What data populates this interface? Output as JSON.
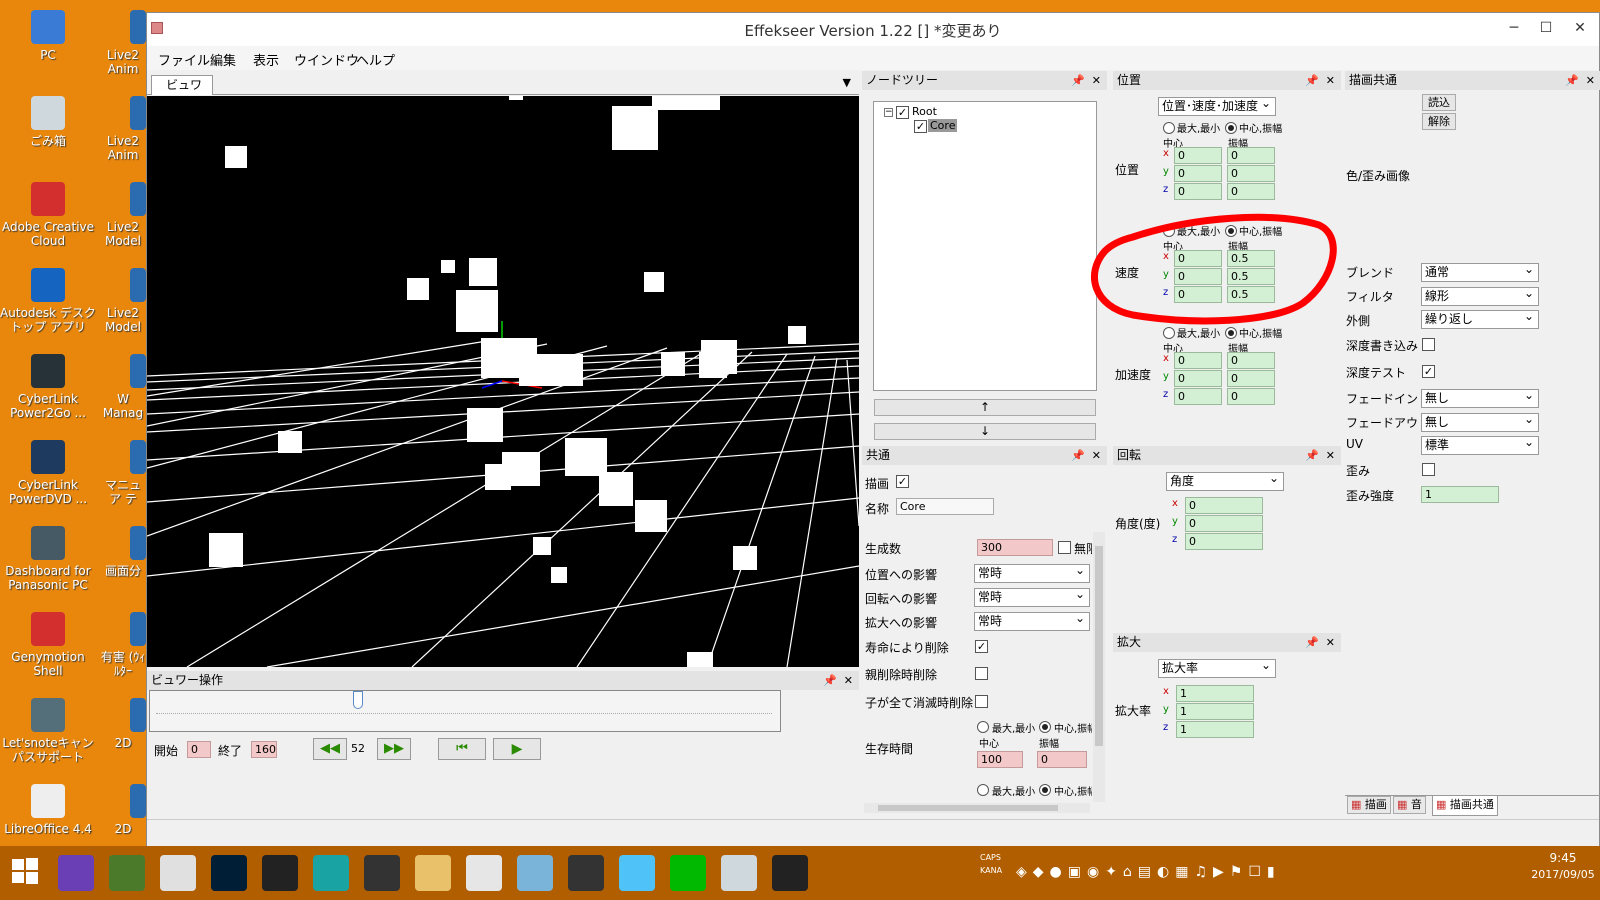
{
  "desktop": {
    "icons_left": [
      {
        "label": "PC",
        "color": "#3a7bd5"
      },
      {
        "label": "ごみ箱",
        "color": "#cfd8dc"
      },
      {
        "label": "Adobe Creative Cloud",
        "color": "#d32f2f"
      },
      {
        "label": "Autodesk デスクトップ アプリ",
        "color": "#1565c0"
      },
      {
        "label": "CyberLink Power2Go ...",
        "color": "#263238"
      },
      {
        "label": "CyberLink PowerDVD ...",
        "color": "#1e3a5f"
      },
      {
        "label": "Dashboard for Panasonic PC",
        "color": "#455a64"
      },
      {
        "label": "Genymotion Shell",
        "color": "#d32f2f"
      },
      {
        "label": "Let'snoteキャンパスサポート",
        "color": "#546e7a"
      },
      {
        "label": "LibreOffice 4.4",
        "color": "#eeeeee"
      }
    ],
    "icons_col2": [
      "Live2 Anim",
      "Live2 Anim",
      "Live2 Model",
      "Live2 Model",
      "W Manag",
      "マニュア テ",
      "画面分",
      "有害 (ｳｨﾙﾀｰ",
      "2D",
      "2D"
    ]
  },
  "window": {
    "title": "Effekseer Version 1.22 []  *変更あり",
    "menu": [
      "ファイル",
      "編集",
      "表示",
      "ウインドウ",
      "ヘルプ"
    ]
  },
  "viewer": {
    "tab_label": "ビュワー",
    "ops_title": "ビュワー操作",
    "start_label": "開始",
    "start_value": "0",
    "end_label": "終了",
    "end_value": "160",
    "frame": "52"
  },
  "node_tree": {
    "title": "ノードツリー",
    "root": "Root",
    "child": "Core",
    "up": "↑",
    "down": "↓"
  },
  "common": {
    "title": "共通",
    "draw_label": "描画",
    "name_label": "名称",
    "name_value": "Core",
    "spawn_label": "生成数",
    "spawn_value": "300",
    "infinite_label": "無限",
    "pos_influence": "位置への影響",
    "rot_influence": "回転への影響",
    "scale_influence": "拡大への影響",
    "always": "常時",
    "delete_by_life": "寿命により削除",
    "delete_on_parent": "親削除時削除",
    "delete_on_children": "子が全て消滅時削除",
    "lifetime_label": "生存時間",
    "minmax": "最大,最小",
    "center_amp": "中心,振幅",
    "center": "中心",
    "amp": "振幅",
    "life_center": "100",
    "life_amp": "0"
  },
  "position": {
    "title": "位置",
    "mode": "位置･速度･加速度",
    "minmax": "最大,最小",
    "center_amp": "中心,振幅",
    "center": "中心",
    "amp": "振幅",
    "pos_label": "位置",
    "vel_label": "速度",
    "acc_label": "加速度",
    "pos": {
      "cx": "0",
      "cy": "0",
      "cz": "0",
      "ax": "0",
      "ay": "0",
      "az": "0"
    },
    "vel": {
      "cx": "0",
      "cy": "0",
      "cz": "0",
      "ax": "0.5",
      "ay": "0.5",
      "az": "0.5"
    },
    "acc": {
      "cx": "0",
      "cy": "0",
      "cz": "0",
      "ax": "0",
      "ay": "0",
      "az": "0"
    }
  },
  "rotation": {
    "title": "回転",
    "mode": "角度",
    "label": "角度(度)",
    "x": "0",
    "y": "0",
    "z": "0"
  },
  "scale": {
    "title": "拡大",
    "mode": "拡大率",
    "label": "拡大率",
    "x": "1",
    "y": "1",
    "z": "1"
  },
  "render_common": {
    "title": "描画共通",
    "load": "読込",
    "release": "解除",
    "tex_label": "色/歪み画像",
    "blend_label": "ブレンド",
    "blend_value": "通常",
    "filter_label": "フィルタ",
    "filter_value": "線形",
    "wrap_label": "外側",
    "wrap_value": "繰り返し",
    "depth_write_label": "深度書き込み",
    "depth_test_label": "深度テスト",
    "fadein_label": "フェードイン",
    "fadein_value": "無し",
    "fadeout_label": "フェードアウト",
    "fadeout_value": "無し",
    "uv_label": "UV",
    "uv_value": "標準",
    "distortion_label": "歪み",
    "distortion_strength_label": "歪み強度",
    "distortion_strength_value": "1",
    "bottom_tabs": [
      "描画",
      "音",
      "描画共通"
    ]
  },
  "xyz": [
    "x",
    "y",
    "z"
  ],
  "taskbar": {
    "time": "9:45",
    "date": "2017/09/05",
    "caps": "CAPS",
    "kana": "KANA"
  },
  "colors": {
    "desktop": "#e8870c",
    "annotation": "#ff0000",
    "field_green": "#d4f0d4",
    "field_pink": "#f2c8c8"
  }
}
